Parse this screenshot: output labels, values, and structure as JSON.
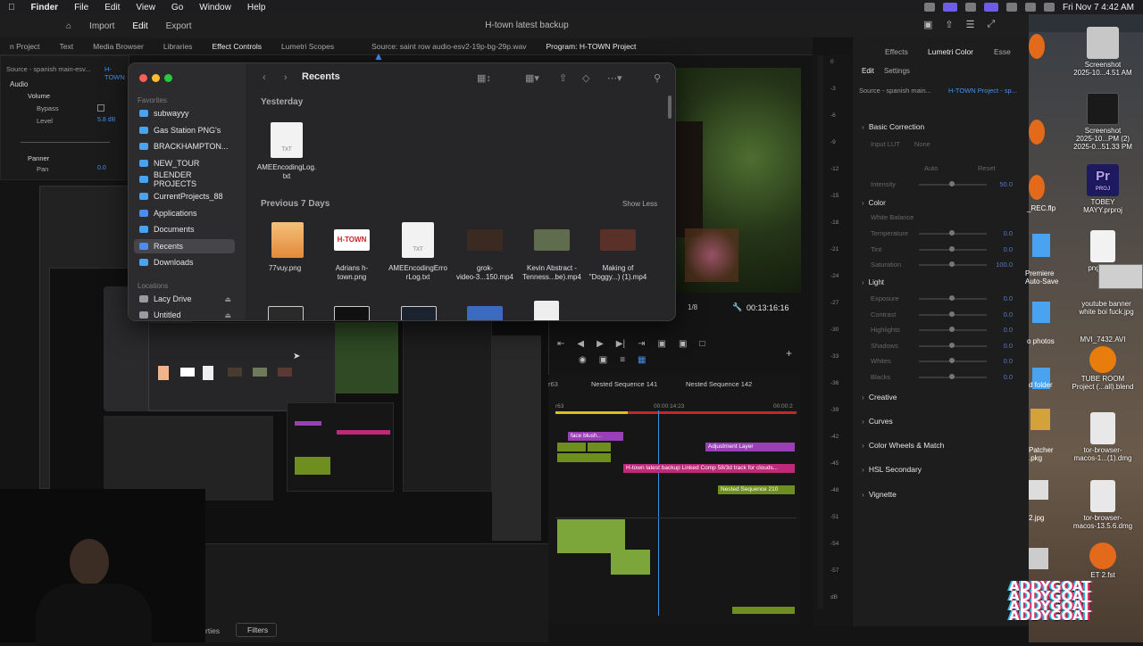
{
  "menubar": {
    "app": "Finder",
    "items": [
      "File",
      "Edit",
      "View",
      "Go",
      "Window",
      "Help"
    ],
    "clock": "Fri Nov 7  4:42 AM"
  },
  "premiere": {
    "nav": [
      "Import",
      "Edit",
      "Export"
    ],
    "title": "H-town latest backup",
    "tabs": [
      "n Project",
      "Text",
      "Media Browser",
      "Libraries",
      "Effect Controls",
      "Lumetri Scopes"
    ],
    "source_tab": "Source: saint row audio-esv2-19p-bg-29p.wav",
    "program_tab": "Program: H-TOWN Project",
    "effect_controls": {
      "source": "Source - spanish main-esv...",
      "sequence": "H-TOWN",
      "audio": "Audio",
      "volume": "Volume",
      "bypass": "Bypass",
      "level": "Level",
      "level_value": "5.8 dB",
      "panner": "Panner",
      "pan": "Pan",
      "pan_value": "0.0"
    },
    "program": {
      "fraction": "1/8",
      "timecode": "00:13:16:16"
    },
    "timeline": {
      "seq1": "Nested Sequence 141",
      "seq2": "Nested Sequence 142",
      "ruler_time": "00:00:14:23",
      "ruler_end": "00:00:2",
      "ruler_start": "r63",
      "clips": {
        "face_blush": "face blush...",
        "adjustment": "Adjustment Layer",
        "linked_comp": "H-town latest backup Linked Comp 58/3d track for clouds...",
        "nested210": "Nested Sequence 210"
      },
      "meter_scale": [
        "0",
        "-3",
        "-6",
        "-9",
        "-12",
        "-15",
        "-18",
        "-21",
        "-24",
        "-27",
        "-30",
        "-33",
        "-36",
        "-39",
        "-42",
        "-45",
        "-48",
        "-51",
        "-54",
        "-57",
        "dB"
      ]
    },
    "bottom": {
      "left_tab": "rties",
      "filters": "Filters"
    }
  },
  "lumetri": {
    "tabs": [
      "Effects",
      "Lumetri Color",
      "Esse"
    ],
    "subtabs": [
      "Edit",
      "Settings"
    ],
    "source": "Source - spanish main...",
    "sequence": "H-TOWN Project - sp...",
    "sections": {
      "basic": "Basic Correction",
      "input_lut": "Input LUT",
      "input_lut_value": "None",
      "auto": "Auto",
      "reset": "Reset",
      "intensity": "Intensity",
      "intensity_value": "50.0",
      "color": "Color",
      "white_balance": "White Balance",
      "light": "Light",
      "creative": "Creative",
      "curves": "Curves",
      "wheels": "Color Wheels & Match",
      "hsl": "HSL Secondary",
      "vignette": "Vignette"
    },
    "color_rows": [
      {
        "label": "Temperature",
        "value": "0.0"
      },
      {
        "label": "Tint",
        "value": "0.0"
      },
      {
        "label": "Saturation",
        "value": "100.0"
      }
    ],
    "light_rows": [
      {
        "label": "Exposure",
        "value": "0.0"
      },
      {
        "label": "Contrast",
        "value": "0.0"
      },
      {
        "label": "Highlights",
        "value": "0.0"
      },
      {
        "label": "Shadows",
        "value": "0.0"
      },
      {
        "label": "Whites",
        "value": "0.0"
      },
      {
        "label": "Blacks",
        "value": "0.0"
      }
    ]
  },
  "finder": {
    "title": "Recents",
    "favorites_heading": "Favorites",
    "favorites": [
      "subwayyy",
      "Gas Station PNG's",
      "BRACKHAMPTON...",
      "NEW_TOUR",
      "BLENDER PROJECTS",
      "CurrentProjects_88",
      "Applications",
      "Documents",
      "Recents",
      "Downloads"
    ],
    "locations_heading": "Locations",
    "locations": [
      "Lacy Drive",
      "Untitled"
    ],
    "group_yesterday": "Yesterday",
    "group_previous": "Previous 7 Days",
    "show_less": "Show Less",
    "yesterday_files": [
      {
        "name": "AMEEncodingLog.\ntxt"
      }
    ],
    "previous_files": [
      {
        "name": "77vuy.png"
      },
      {
        "name": "Adrians h-\ntown.png"
      },
      {
        "name": "AMEEncodingErro\nrLog.txt"
      },
      {
        "name": "grok-\nvideo-3...150.mp4"
      },
      {
        "name": "Kevin Abstract -\nTenness...be).mp4"
      },
      {
        "name": "Making of\n\"Doggy...) (1).mp4"
      }
    ],
    "htown_logo": "H-TOWN"
  },
  "desktop": {
    "icons": [
      {
        "label": "Screenshot\n2025-10...4.51 AM"
      },
      {
        "label": "Screenshot\n2025-10...PM (2)\n2025-0...51.33 PM"
      },
      {
        "label": "TOBEY\nMAYY.prproj"
      },
      {
        "label": "pngggg...\n"
      },
      {
        "label": "youtube banner\nwhite boi fuck.jpg"
      },
      {
        "label": "MVI_7432.AVI"
      },
      {
        "label": "TUBE ROOM\nProject (...all).blend"
      },
      {
        "label": "tor-browser-\nmacos-1...(1).dmg"
      },
      {
        "label": "tor-browser-\nmacos-13.5.6.dmg"
      },
      {
        "label": "ET 2.fst"
      }
    ],
    "partial_labels": [
      "_REC.flp",
      "Premiere\nAuto-Save",
      "o photos",
      "d folder",
      "Patcher\n.pkg",
      "2.jpg"
    ],
    "pr_badge": "Pr",
    "pr_badge_sub": "PROJ",
    "watermark": [
      "ADDYGOAT",
      "ADDYGOAT",
      "ADDYGOAT",
      "ADDYGOAT"
    ]
  },
  "colors": {
    "accent_blue": "#2a7de1",
    "premiere_purple": "#9a3fb5",
    "clip_pink": "#c0287a",
    "clip_green": "#6e8f1f",
    "finder_folder": "#4aa3f0"
  }
}
